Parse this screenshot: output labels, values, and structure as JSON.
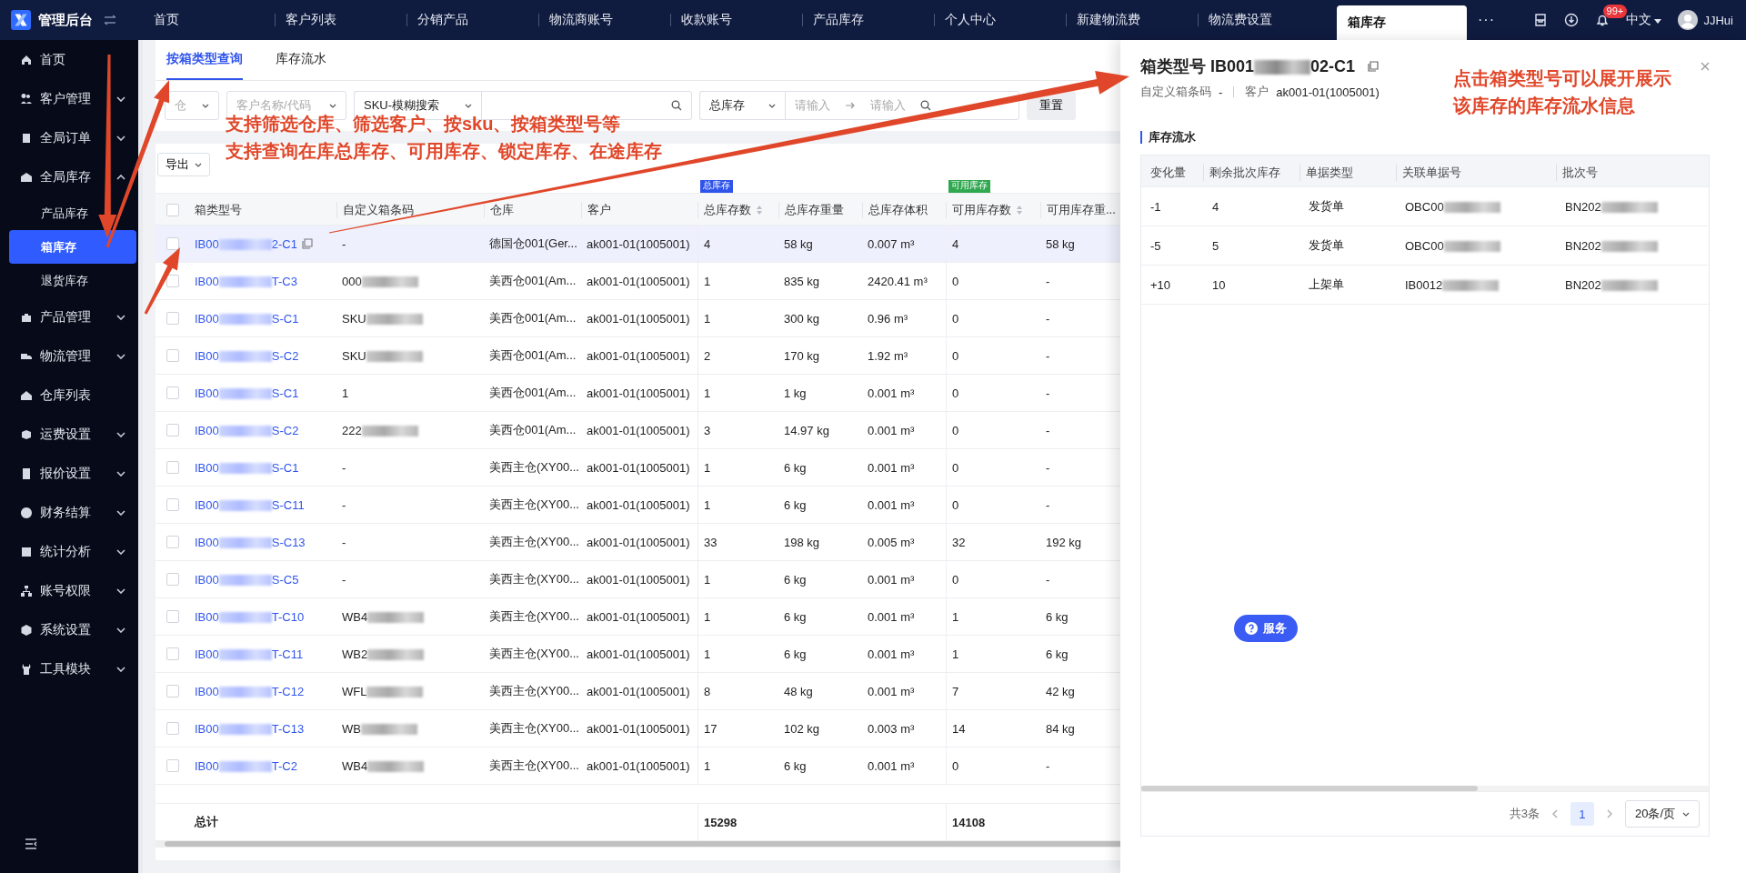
{
  "top_bar": {
    "app_name": "管理后台",
    "tabs": [
      {
        "label": "首页",
        "selected": false
      },
      {
        "label": "客户列表",
        "selected": false
      },
      {
        "label": "分销产品",
        "selected": false
      },
      {
        "label": "物流商账号",
        "selected": false
      },
      {
        "label": "收款账号",
        "selected": false
      },
      {
        "label": "产品库存",
        "selected": false
      },
      {
        "label": "个人中心",
        "selected": false
      },
      {
        "label": "新建物流费",
        "selected": false
      },
      {
        "label": "物流费设置",
        "selected": false
      },
      {
        "label": "箱库存",
        "selected": true
      }
    ],
    "more": "···",
    "notification_badge": "99+",
    "language": "中文",
    "user": "JJHui"
  },
  "sidebar": {
    "items": [
      {
        "label": "首页",
        "kind": "link"
      },
      {
        "label": "客户管理",
        "kind": "group",
        "expanded": false
      },
      {
        "label": "全局订单",
        "kind": "group",
        "expanded": false
      },
      {
        "label": "全局库存",
        "kind": "group",
        "expanded": true,
        "children": [
          {
            "label": "产品库存",
            "selected": false
          },
          {
            "label": "箱库存",
            "selected": true
          },
          {
            "label": "退货库存",
            "selected": false
          }
        ]
      },
      {
        "label": "产品管理",
        "kind": "group",
        "expanded": false
      },
      {
        "label": "物流管理",
        "kind": "group",
        "expanded": false
      },
      {
        "label": "仓库列表",
        "kind": "link"
      },
      {
        "label": "运费设置",
        "kind": "group",
        "expanded": false
      },
      {
        "label": "报价设置",
        "kind": "group",
        "expanded": false
      },
      {
        "label": "财务结算",
        "kind": "group",
        "expanded": false
      },
      {
        "label": "统计分析",
        "kind": "group",
        "expanded": false
      },
      {
        "label": "账号权限",
        "kind": "group",
        "expanded": false
      },
      {
        "label": "系统设置",
        "kind": "group",
        "expanded": false
      },
      {
        "label": "工具模块",
        "kind": "group",
        "expanded": false
      }
    ]
  },
  "page_tabs": [
    {
      "label": "按箱类型查询",
      "selected": true
    },
    {
      "label": "库存流水",
      "selected": false
    }
  ],
  "filters": {
    "warehouse": {
      "placeholder": "仓"
    },
    "customer": {
      "placeholder": "客户名称/代码"
    },
    "sku_mode": "SKU-模糊搜索",
    "stock_type": "总库存",
    "range_from": {
      "placeholder": "请输入"
    },
    "range_to": {
      "placeholder": "请输入"
    },
    "reset": "重置"
  },
  "export_button": "导出",
  "table": {
    "select_all_checked": false,
    "groups": [
      {
        "label": "总库存",
        "color": "#2f54eb"
      },
      {
        "label": "可用库存",
        "color": "#2fa84f"
      }
    ],
    "columns": [
      {
        "label": "箱类型号",
        "sortable": false
      },
      {
        "label": "自定义箱条码",
        "sortable": false
      },
      {
        "label": "仓库",
        "sortable": false
      },
      {
        "label": "客户",
        "sortable": false
      },
      {
        "label": "总库存数",
        "sortable": true
      },
      {
        "label": "总库存重量",
        "sortable": false
      },
      {
        "label": "总库存体积",
        "sortable": false
      },
      {
        "label": "可用库存数",
        "sortable": true
      },
      {
        "label": "可用库存重..."
      }
    ],
    "rows": [
      {
        "selected": true,
        "checked": false,
        "box_type": {
          "head": "IB00",
          "tail": "2-C1",
          "copy_icon": true
        },
        "barcode": {
          "text": "-",
          "blurred": false
        },
        "warehouse": "德国仓001(Ger...",
        "customer": "ak001-01(1005001)",
        "total_qty": "4",
        "total_weight": "58 kg",
        "total_volume": "0.007 m³",
        "avail_qty": "4",
        "avail_weight": "58 kg"
      },
      {
        "selected": false,
        "checked": false,
        "box_type": {
          "head": "IB00",
          "tail": "T-C3",
          "copy_icon": false
        },
        "barcode": {
          "text": "000",
          "blurred": true
        },
        "warehouse": "美西仓001(Am...",
        "customer": "ak001-01(1005001)",
        "total_qty": "1",
        "total_weight": "835 kg",
        "total_volume": "2420.41 m³",
        "avail_qty": "0",
        "avail_weight": "-"
      },
      {
        "selected": false,
        "checked": false,
        "box_type": {
          "head": "IB00",
          "tail": "S-C1",
          "copy_icon": false
        },
        "barcode": {
          "text": "SKU",
          "blurred": true
        },
        "warehouse": "美西仓001(Am...",
        "customer": "ak001-01(1005001)",
        "total_qty": "1",
        "total_weight": "300 kg",
        "total_volume": "0.96 m³",
        "avail_qty": "0",
        "avail_weight": "-"
      },
      {
        "selected": false,
        "checked": false,
        "box_type": {
          "head": "IB00",
          "tail": "S-C2",
          "copy_icon": false
        },
        "barcode": {
          "text": "SKU",
          "blurred": true
        },
        "warehouse": "美西仓001(Am...",
        "customer": "ak001-01(1005001)",
        "total_qty": "2",
        "total_weight": "170 kg",
        "total_volume": "1.92 m³",
        "avail_qty": "0",
        "avail_weight": "-"
      },
      {
        "selected": false,
        "checked": false,
        "box_type": {
          "head": "IB00",
          "tail": "S-C1",
          "copy_icon": false
        },
        "barcode": {
          "text": "1",
          "blurred": false
        },
        "warehouse": "美西仓001(Am...",
        "customer": "ak001-01(1005001)",
        "total_qty": "1",
        "total_weight": "1 kg",
        "total_volume": "0.001 m³",
        "avail_qty": "0",
        "avail_weight": "-"
      },
      {
        "selected": false,
        "checked": false,
        "box_type": {
          "head": "IB00",
          "tail": "S-C2",
          "copy_icon": false
        },
        "barcode": {
          "text": "222",
          "blurred": true
        },
        "warehouse": "美西仓001(Am...",
        "customer": "ak001-01(1005001)",
        "total_qty": "3",
        "total_weight": "14.97 kg",
        "total_volume": "0.001 m³",
        "avail_qty": "0",
        "avail_weight": "-"
      },
      {
        "selected": false,
        "checked": false,
        "box_type": {
          "head": "IB00",
          "tail": "S-C1",
          "copy_icon": false
        },
        "barcode": {
          "text": "-",
          "blurred": false
        },
        "warehouse": "美西主仓(XY00...",
        "customer": "ak001-01(1005001)",
        "total_qty": "1",
        "total_weight": "6 kg",
        "total_volume": "0.001 m³",
        "avail_qty": "0",
        "avail_weight": "-"
      },
      {
        "selected": false,
        "checked": false,
        "box_type": {
          "head": "IB00",
          "tail": "S-C11",
          "copy_icon": false
        },
        "barcode": {
          "text": "-",
          "blurred": false
        },
        "warehouse": "美西主仓(XY00...",
        "customer": "ak001-01(1005001)",
        "total_qty": "1",
        "total_weight": "6 kg",
        "total_volume": "0.001 m³",
        "avail_qty": "0",
        "avail_weight": "-"
      },
      {
        "selected": false,
        "checked": false,
        "box_type": {
          "head": "IB00",
          "tail": "S-C13",
          "copy_icon": false
        },
        "barcode": {
          "text": "-",
          "blurred": false
        },
        "warehouse": "美西主仓(XY00...",
        "customer": "ak001-01(1005001)",
        "total_qty": "33",
        "total_weight": "198 kg",
        "total_volume": "0.005 m³",
        "avail_qty": "32",
        "avail_weight": "192 kg"
      },
      {
        "selected": false,
        "checked": false,
        "box_type": {
          "head": "IB00",
          "tail": "S-C5",
          "copy_icon": false
        },
        "barcode": {
          "text": "-",
          "blurred": false
        },
        "warehouse": "美西主仓(XY00...",
        "customer": "ak001-01(1005001)",
        "total_qty": "1",
        "total_weight": "6 kg",
        "total_volume": "0.001 m³",
        "avail_qty": "0",
        "avail_weight": "-"
      },
      {
        "selected": false,
        "checked": false,
        "box_type": {
          "head": "IB00",
          "tail": "T-C10",
          "copy_icon": false
        },
        "barcode": {
          "text": "WB4",
          "blurred": true
        },
        "warehouse": "美西主仓(XY00...",
        "customer": "ak001-01(1005001)",
        "total_qty": "1",
        "total_weight": "6 kg",
        "total_volume": "0.001 m³",
        "avail_qty": "1",
        "avail_weight": "6 kg"
      },
      {
        "selected": false,
        "checked": false,
        "box_type": {
          "head": "IB00",
          "tail": "T-C11",
          "copy_icon": false
        },
        "barcode": {
          "text": "WB2",
          "blurred": true
        },
        "warehouse": "美西主仓(XY00...",
        "customer": "ak001-01(1005001)",
        "total_qty": "1",
        "total_weight": "6 kg",
        "total_volume": "0.001 m³",
        "avail_qty": "1",
        "avail_weight": "6 kg"
      },
      {
        "selected": false,
        "checked": false,
        "box_type": {
          "head": "IB00",
          "tail": "T-C12",
          "copy_icon": false
        },
        "barcode": {
          "text": "WFL",
          "blurred": true
        },
        "warehouse": "美西主仓(XY00...",
        "customer": "ak001-01(1005001)",
        "total_qty": "8",
        "total_weight": "48 kg",
        "total_volume": "0.001 m³",
        "avail_qty": "7",
        "avail_weight": "42 kg"
      },
      {
        "selected": false,
        "checked": false,
        "box_type": {
          "head": "IB00",
          "tail": "T-C13",
          "copy_icon": false
        },
        "barcode": {
          "text": "WB",
          "blurred": true
        },
        "warehouse": "美西主仓(XY00...",
        "customer": "ak001-01(1005001)",
        "total_qty": "17",
        "total_weight": "102 kg",
        "total_volume": "0.003 m³",
        "avail_qty": "14",
        "avail_weight": "84 kg"
      },
      {
        "selected": false,
        "checked": false,
        "box_type": {
          "head": "IB00",
          "tail": "T-C2",
          "copy_icon": false
        },
        "barcode": {
          "text": "WB4",
          "blurred": true
        },
        "warehouse": "美西主仓(XY00...",
        "customer": "ak001-01(1005001)",
        "total_qty": "1",
        "total_weight": "6 kg",
        "total_volume": "0.001 m³",
        "avail_qty": "0",
        "avail_weight": "-"
      }
    ],
    "total": {
      "label": "总计",
      "total_qty": "15298",
      "avail_qty": "14108"
    }
  },
  "drawer": {
    "title_label": "箱类型号",
    "title_head": "IB001",
    "title_tail": "02-C1",
    "barcode_label": "自定义箱条码",
    "barcode_value": "-",
    "customer_label": "客户",
    "customer_value": "ak001-01(1005001)",
    "section_title": "库存流水",
    "columns": [
      "变化量",
      "剩余批次库存",
      "单据类型",
      "关联单据号",
      "批次号"
    ],
    "rows": [
      {
        "change": "-1",
        "remaining": "4",
        "doc_type": "发货单",
        "doc_no": "OBC00",
        "batch": "BN202"
      },
      {
        "change": "-5",
        "remaining": "5",
        "doc_type": "发货单",
        "doc_no": "OBC00",
        "batch": "BN202"
      },
      {
        "change": "+10",
        "remaining": "10",
        "doc_type": "上架单",
        "doc_no": "IB0012",
        "batch": "BN202"
      }
    ],
    "pagination": {
      "total": "共3条",
      "pages": [
        {
          "label": "1",
          "selected": true
        }
      ],
      "page_size": "20条/页"
    }
  },
  "service_button": "服务",
  "annotations": [
    {
      "lines": [
        "支持筛选仓库、筛选客户、按sku、按箱类型号等",
        "支持查询在库总库存、可用库存、锁定库存、在途库存"
      ]
    },
    {
      "lines": [
        "点击箱类型号可以展开展示",
        "该库存的库存流水信息"
      ]
    }
  ]
}
